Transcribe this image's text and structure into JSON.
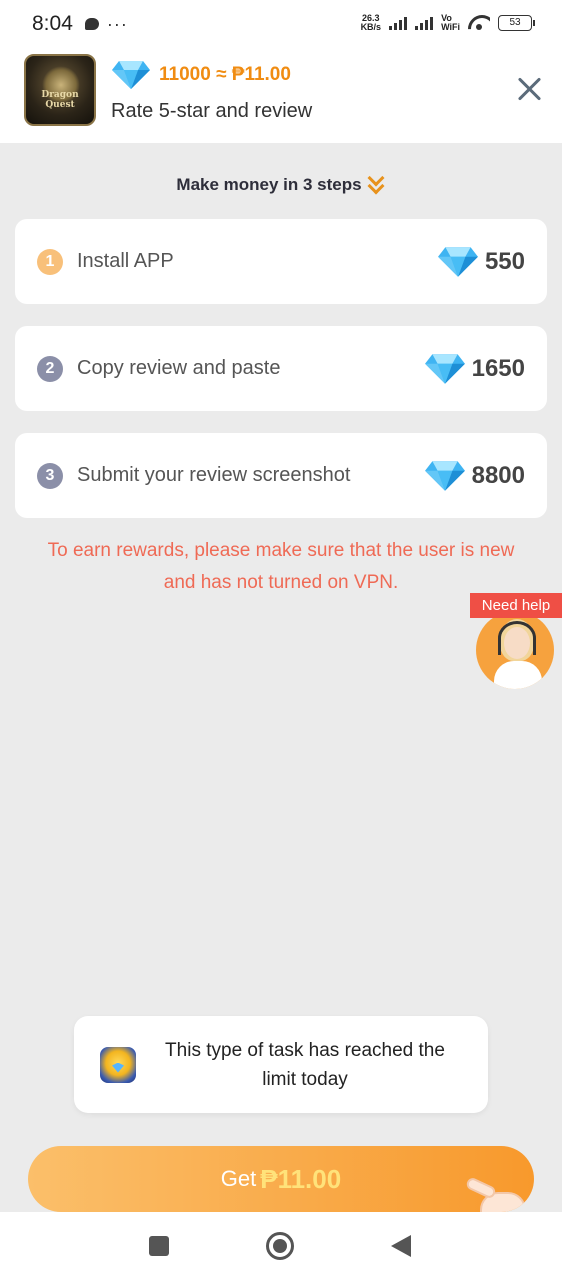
{
  "status_bar": {
    "time": "8:04",
    "more": "···",
    "net_speed_value": "26.3",
    "net_speed_unit": "KB/s",
    "vowifi_top": "Vo",
    "vowifi_bottom": "WiFi",
    "battery": "53"
  },
  "header": {
    "app_logo_text": "Dragon Quest",
    "reward": "11000 ≈ ₱11.00",
    "title": "Rate 5-star and review"
  },
  "steps_heading": "Make money in 3 steps",
  "steps": [
    {
      "number": "1",
      "label": "Install APP",
      "value": "550",
      "badge_color": "#f8c07a"
    },
    {
      "number": "2",
      "label": "Copy review and paste",
      "value": "1650",
      "badge_color": "#8b8fa8"
    },
    {
      "number": "3",
      "label": "Submit  your review screenshot",
      "value": "8800",
      "badge_color": "#8b8fa8"
    }
  ],
  "notice": "To earn rewards, please make sure that the user is new and has not turned on VPN.",
  "need_help": "Need help",
  "toast": {
    "message": "This type of task has reached the limit today"
  },
  "get_button": {
    "prefix": "Get",
    "amount": "₱11.00"
  },
  "colors": {
    "accent_orange": "#f08c12",
    "notice_red": "#ef6a55",
    "help_red": "#ef4f45"
  }
}
